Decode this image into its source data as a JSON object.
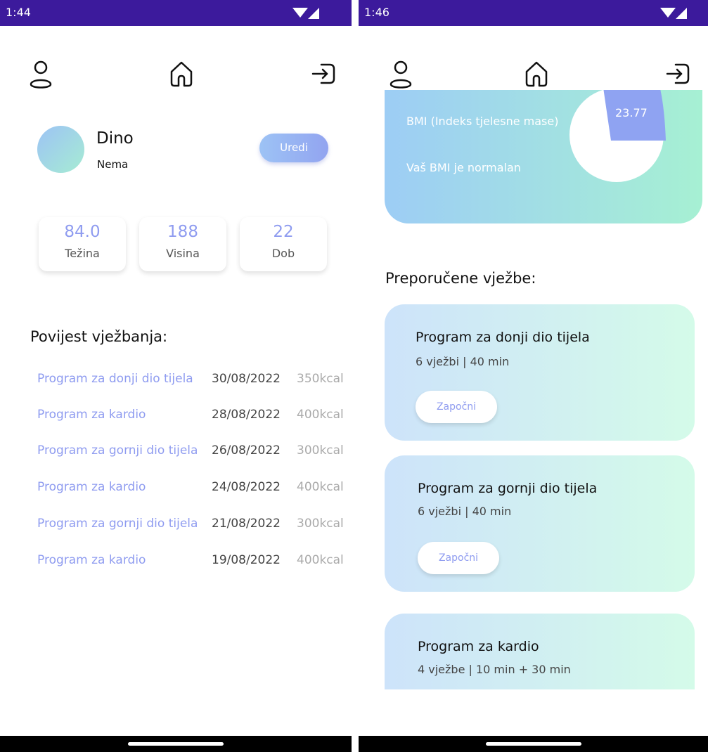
{
  "left_screen": {
    "status_time": "1:44",
    "profile": {
      "name": "Dino",
      "subtitle": "Nema",
      "edit_label": "Uredi"
    },
    "stats": [
      {
        "value": "84.0",
        "label": "Težina"
      },
      {
        "value": "188",
        "label": "Visina"
      },
      {
        "value": "22",
        "label": "Dob"
      }
    ],
    "history_title": "Povijest vježbanja:",
    "history": [
      {
        "program": "Program za donji dio tijela",
        "date": "30/08/2022",
        "kcal": "350kcal"
      },
      {
        "program": "Program za kardio",
        "date": "28/08/2022",
        "kcal": "400kcal"
      },
      {
        "program": "Program za gornji dio tijela",
        "date": "26/08/2022",
        "kcal": "300kcal"
      },
      {
        "program": "Program za kardio",
        "date": "24/08/2022",
        "kcal": "400kcal"
      },
      {
        "program": "Program za gornji dio tijela",
        "date": "21/08/2022",
        "kcal": "300kcal"
      },
      {
        "program": "Program za kardio",
        "date": "19/08/2022",
        "kcal": "400kcal"
      }
    ]
  },
  "right_screen": {
    "status_time": "1:46",
    "bmi": {
      "title": "BMI (Indeks tjelesne mase)",
      "status": "Vaš BMI je normalan",
      "value": "23.77"
    },
    "recommended_title": "Preporučene vježbe:",
    "programs": [
      {
        "title": "Program za donji dio tijela",
        "meta": "6 vježbi | 40 min",
        "button": "Započni"
      },
      {
        "title": "Program za gornji dio tijela",
        "meta": "6 vježbi | 40 min",
        "button": "Započni"
      },
      {
        "title": "Program za kardio",
        "meta": "4 vježbe | 10 min + 30 min"
      }
    ]
  },
  "icons": {
    "profile": "user-icon",
    "home": "home-icon",
    "logout": "logout-icon",
    "wifi": "wifi-icon",
    "signal": "signal-icon"
  },
  "colors": {
    "status_bar": "#3c1a9c",
    "accent": "#8f9cf0",
    "gradient_blue": "#9dc3f5",
    "gradient_green": "#a6ecd3"
  }
}
